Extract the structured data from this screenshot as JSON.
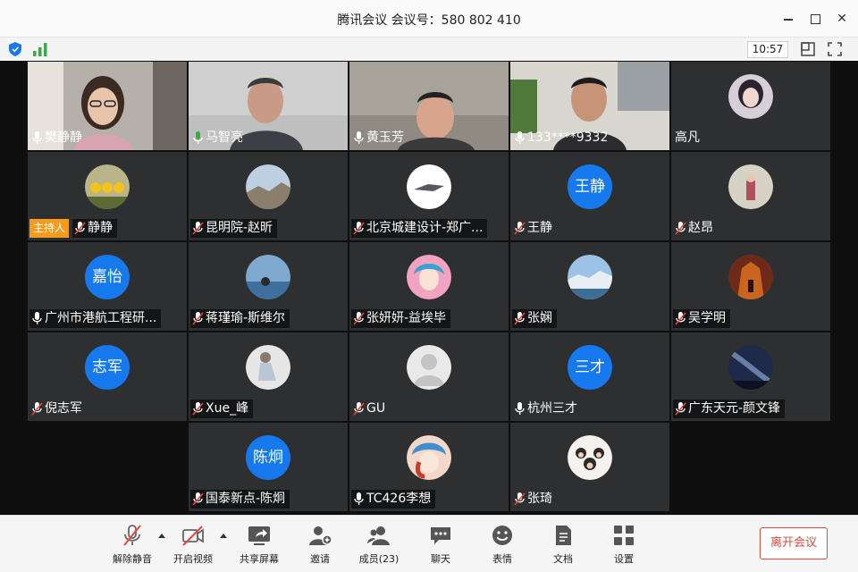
{
  "window": {
    "title": "腾讯会议 会议号：580 802 410"
  },
  "infobar": {
    "time": "10:57"
  },
  "participants_row1": [
    {
      "name": "樊静静",
      "type": "camera"
    },
    {
      "name": "马智亮",
      "type": "camera",
      "speaking": true
    },
    {
      "name": "黄玉芳",
      "type": "camera"
    },
    {
      "name": "133****9332",
      "type": "camera"
    },
    {
      "name": "高凡",
      "type": "avatar-image"
    }
  ],
  "participants_row2": [
    {
      "name": "静静",
      "host": true,
      "host_label": "主持人"
    },
    {
      "name": "昆明院-赵昕"
    },
    {
      "name": "北京城建设计-郑广..."
    },
    {
      "name": "王静",
      "avatar_text": "王静"
    },
    {
      "name": "赵昂"
    }
  ],
  "participants_row3": [
    {
      "name": "广州市港航工程研...",
      "avatar_text": "嘉怡"
    },
    {
      "name": "蒋瑾瑜-斯维尔"
    },
    {
      "name": "张妍妍-益埃毕"
    },
    {
      "name": "张娴"
    },
    {
      "name": "吴学明"
    }
  ],
  "participants_row4": [
    {
      "name": "倪志军",
      "avatar_text": "志军"
    },
    {
      "name": "Xue_峰"
    },
    {
      "name": "GU"
    },
    {
      "name": "杭州三才",
      "avatar_text": "三才"
    },
    {
      "name": "广东天元-颜文锋"
    }
  ],
  "participants_row5": [
    {
      "name": "国泰新点-陈炯",
      "avatar_text": "陈炯"
    },
    {
      "name": "TC426李想"
    },
    {
      "name": "张琦"
    }
  ],
  "toolbar": {
    "unmute": "解除静音",
    "start_video": "开启视频",
    "share_screen": "共享屏幕",
    "invite": "邀请",
    "members": "成员(23)",
    "chat": "聊天",
    "reactions": "表情",
    "docs": "文档",
    "settings": "设置",
    "leave": "离开会议"
  },
  "colors": {
    "accent": "#1779ee",
    "host_badge": "#f59b1d",
    "leave": "#e3493c",
    "tile_bg": "#2e2f31"
  }
}
